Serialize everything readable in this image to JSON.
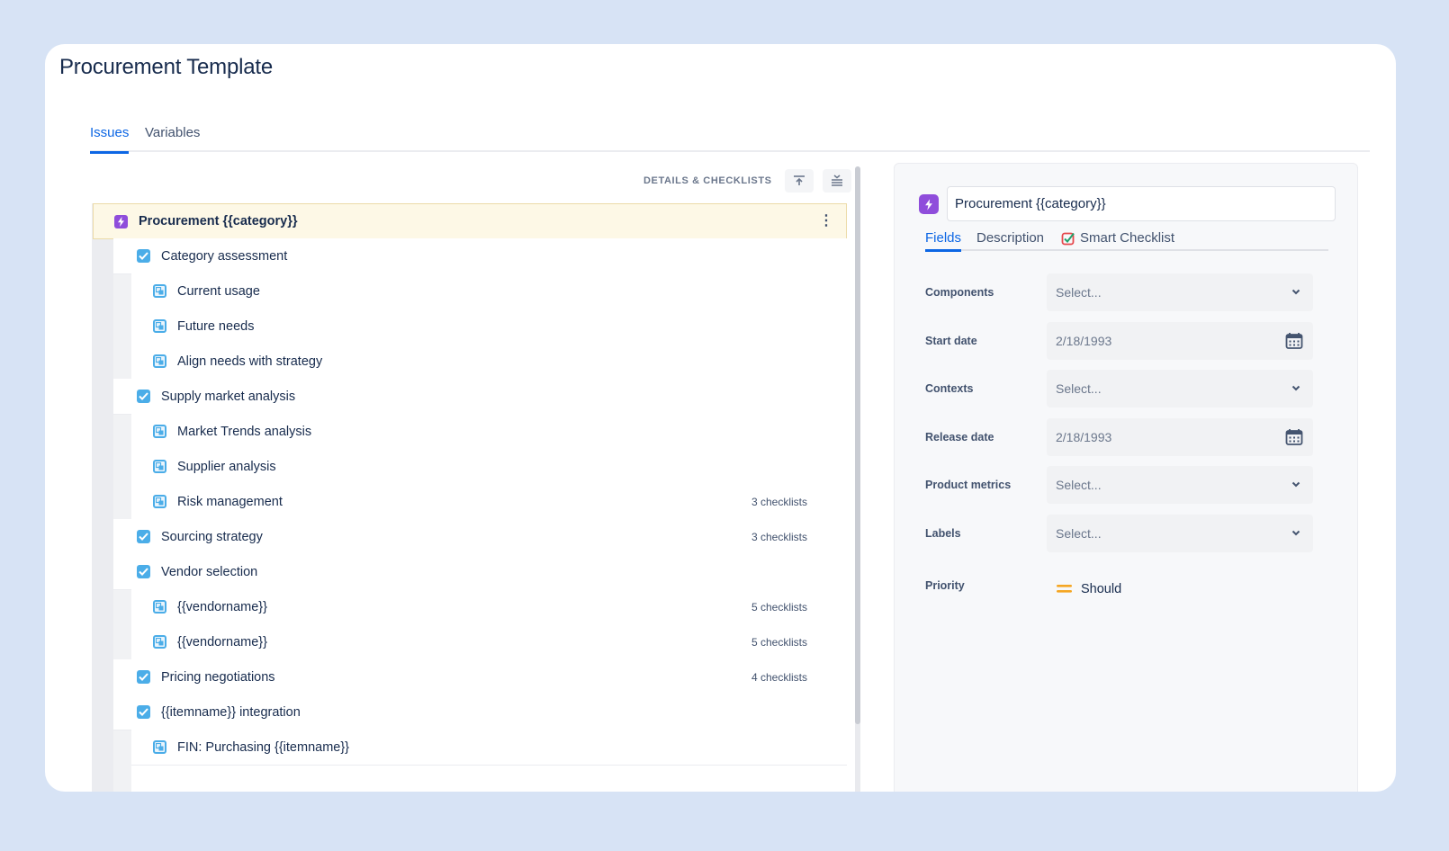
{
  "page": {
    "title": "Procurement Template"
  },
  "tabs": [
    "Issues",
    "Variables"
  ],
  "toolbar": {
    "label": "DETAILS & CHECKLISTS",
    "collapse_icon": "collapse-icon",
    "expand_icon": "expand-all-icon"
  },
  "tree": {
    "root": {
      "label": "Procurement {{category}}",
      "icon": "epic-icon",
      "menu_icon": "more-vertical-icon"
    },
    "rows": [
      {
        "label": "Category assessment",
        "level": 1,
        "icon": "checkbox-icon",
        "count": ""
      },
      {
        "label": "Current usage",
        "level": 2,
        "icon": "subtask-icon",
        "count": ""
      },
      {
        "label": "Future needs",
        "level": 2,
        "icon": "subtask-icon",
        "count": ""
      },
      {
        "label": "Align needs with strategy",
        "level": 2,
        "icon": "subtask-icon",
        "count": ""
      },
      {
        "label": "Supply market analysis",
        "level": 1,
        "icon": "checkbox-icon",
        "count": ""
      },
      {
        "label": "Market Trends analysis",
        "level": 2,
        "icon": "subtask-icon",
        "count": ""
      },
      {
        "label": "Supplier analysis",
        "level": 2,
        "icon": "subtask-icon",
        "count": ""
      },
      {
        "label": "Risk management",
        "level": 2,
        "icon": "subtask-icon",
        "count": "3 checklists"
      },
      {
        "label": "Sourcing strategy",
        "level": 1,
        "icon": "checkbox-icon",
        "count": "3 checklists"
      },
      {
        "label": "Vendor selection",
        "level": 1,
        "icon": "checkbox-icon",
        "count": ""
      },
      {
        "label": "{{vendorname}}",
        "level": 2,
        "icon": "subtask-icon",
        "count": "5 checklists"
      },
      {
        "label": "{{vendorname}}",
        "level": 2,
        "icon": "subtask-icon",
        "count": "5 checklists"
      },
      {
        "label": "Pricing negotiations",
        "level": 1,
        "icon": "checkbox-icon",
        "count": "4 checklists"
      },
      {
        "label": "{{itemname}} integration",
        "level": 1,
        "icon": "checkbox-icon",
        "count": ""
      },
      {
        "label": "FIN: Purchasing {{itemname}}",
        "level": 2,
        "icon": "subtask-icon",
        "count": ""
      }
    ]
  },
  "detail": {
    "title_value": "Procurement {{category}}",
    "tabs": [
      "Fields",
      "Description",
      "Smart Checklist"
    ],
    "fields": [
      {
        "label": "Components",
        "value": "Select...",
        "control": "select"
      },
      {
        "label": "Start date",
        "value": "2/18/1993",
        "control": "date"
      },
      {
        "label": "Contexts",
        "value": "Select...",
        "control": "select"
      },
      {
        "label": "Release date",
        "value": "2/18/1993",
        "control": "date"
      },
      {
        "label": "Product metrics",
        "value": "Select...",
        "control": "select"
      },
      {
        "label": "Labels",
        "value": "Select...",
        "control": "select"
      }
    ],
    "priority": {
      "label": "Priority",
      "value": "Should",
      "icon": "priority-medium-icon",
      "color": "#f5a623"
    }
  },
  "colors": {
    "accent": "#0c66e4",
    "epic": "#8f4ddb",
    "task": "#4bade8",
    "root_highlight": "#fdf8e6",
    "background": "#d7e3f5"
  }
}
